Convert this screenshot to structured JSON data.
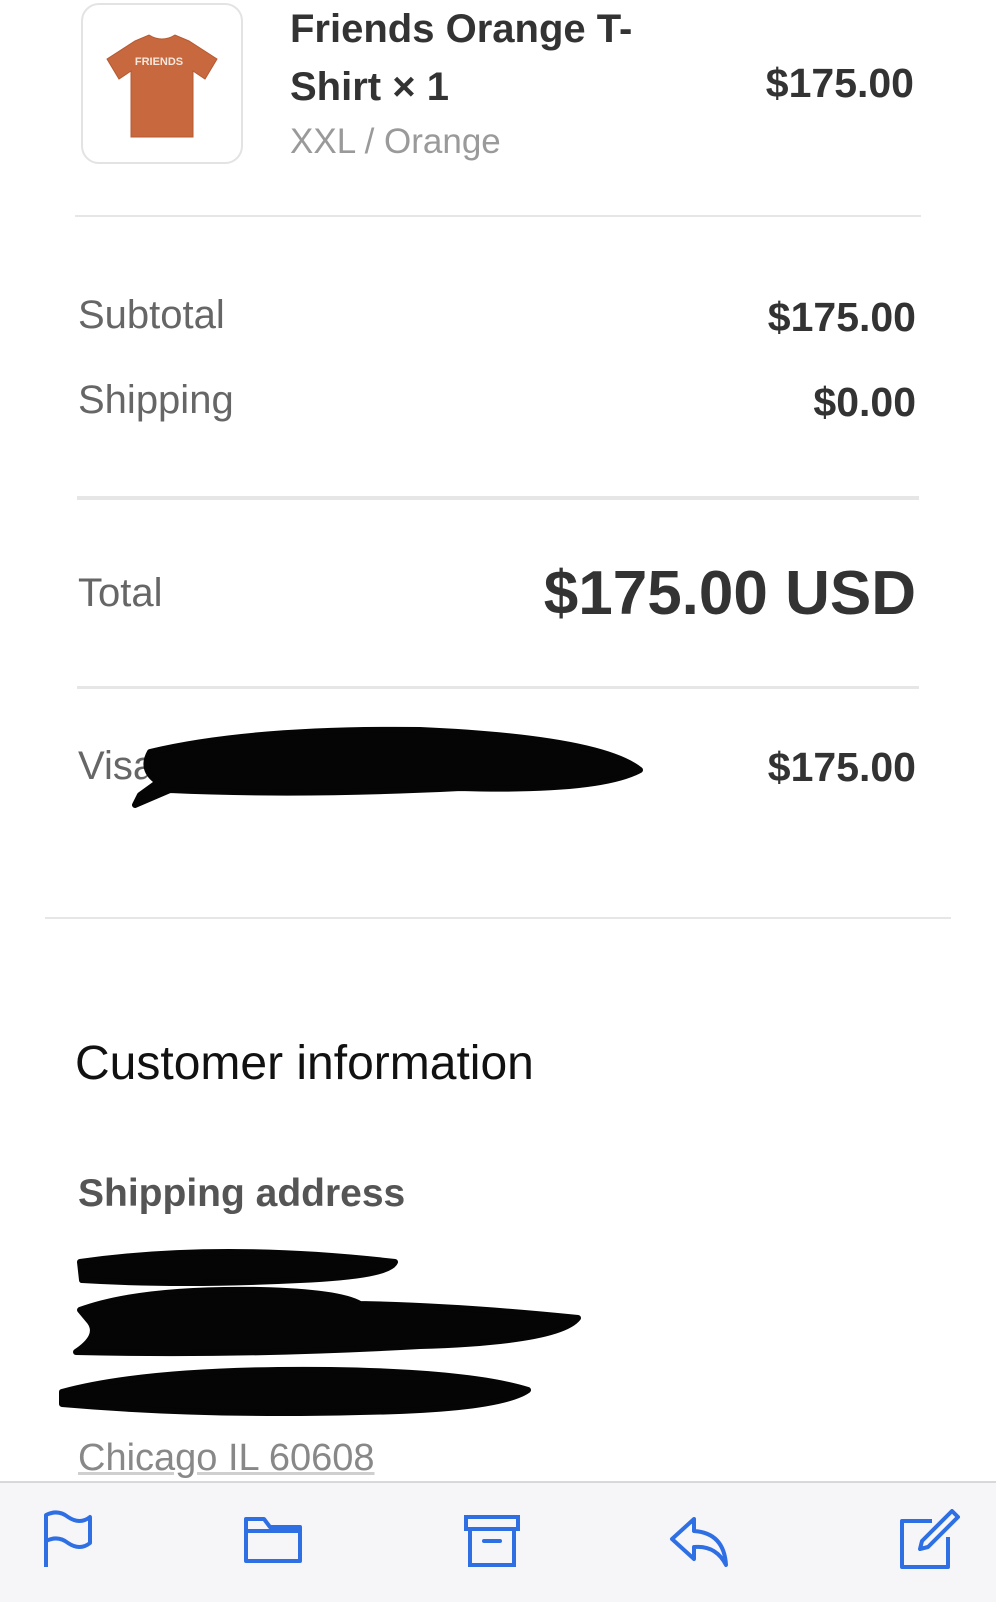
{
  "product": {
    "name_line1": "Friends Orange T-",
    "name_line2": "Shirt × 1",
    "variant": "XXL / Orange",
    "price": "$175.00",
    "shirt_print": "FRIENDS"
  },
  "summary": {
    "subtotal_label": "Subtotal",
    "subtotal_value": "$175.00",
    "shipping_label": "Shipping",
    "shipping_value": "$0.00",
    "total_label": "Total",
    "total_value": "$175.00 USD",
    "payment_label": "Visa",
    "payment_value": "$175.00"
  },
  "customer": {
    "heading": "Customer information",
    "shipping_heading": "Shipping address",
    "address_city_line": "Chicago IL 60608"
  },
  "toolbar": {
    "icons": [
      "flag-icon",
      "folder-icon",
      "archive-icon",
      "reply-icon",
      "compose-icon"
    ],
    "accent_color": "#2f6fe4"
  },
  "colors": {
    "shirt": "#c8683e",
    "redaction": "#050505"
  }
}
